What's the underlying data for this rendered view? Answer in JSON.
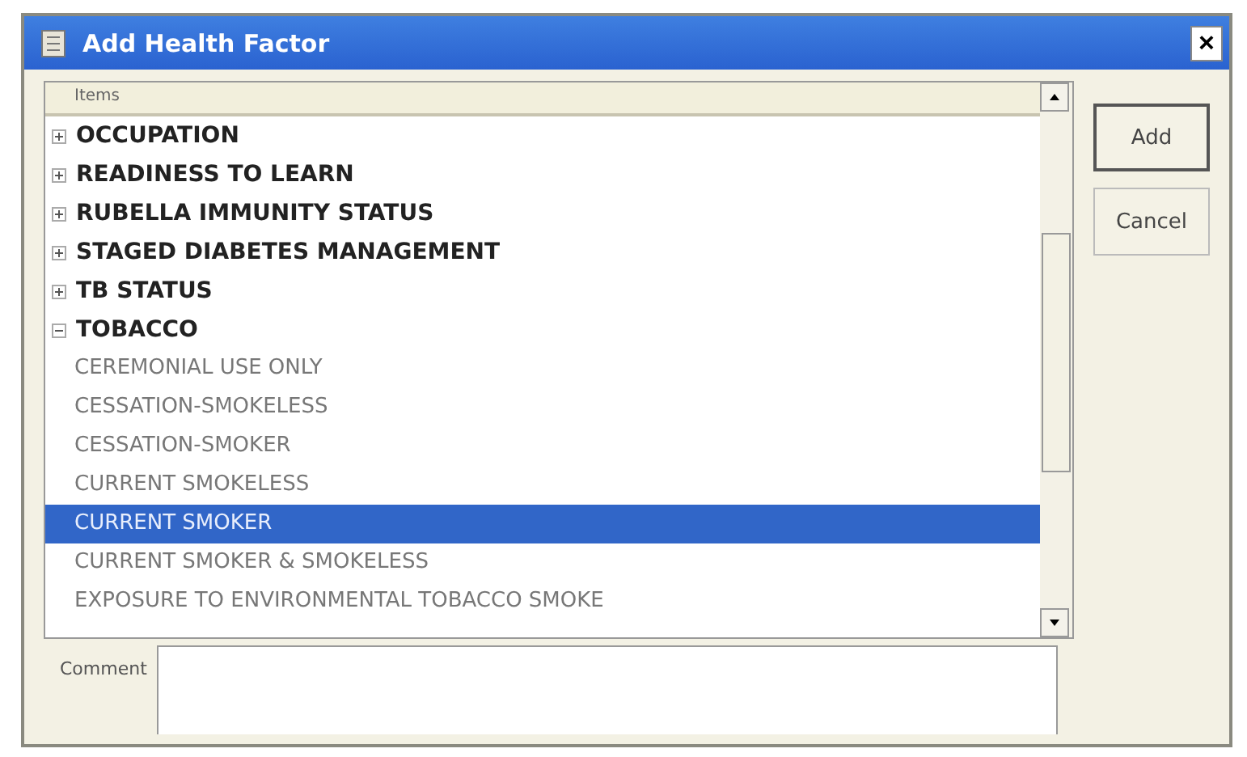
{
  "window": {
    "title": "Add Health Factor",
    "close": "×"
  },
  "list": {
    "column": "Items",
    "items": [
      {
        "label": "OCCUPATION",
        "expanded": false
      },
      {
        "label": "READINESS TO LEARN",
        "expanded": false
      },
      {
        "label": "RUBELLA IMMUNITY STATUS",
        "expanded": false
      },
      {
        "label": "STAGED DIABETES MANAGEMENT",
        "expanded": false
      },
      {
        "label": "TB STATUS",
        "expanded": false
      },
      {
        "label": "TOBACCO",
        "expanded": true,
        "children": [
          {
            "label": "CEREMONIAL USE ONLY",
            "selected": false
          },
          {
            "label": "CESSATION-SMOKELESS",
            "selected": false
          },
          {
            "label": "CESSATION-SMOKER",
            "selected": false
          },
          {
            "label": "CURRENT SMOKELESS",
            "selected": false
          },
          {
            "label": "CURRENT SMOKER",
            "selected": true
          },
          {
            "label": "CURRENT SMOKER & SMOKELESS",
            "selected": false
          },
          {
            "label": "EXPOSURE TO ENVIRONMENTAL TOBACCO SMOKE",
            "selected": false
          }
        ]
      }
    ]
  },
  "comment": {
    "label": "Comment"
  },
  "buttons": [
    "Add",
    "Cancel"
  ]
}
